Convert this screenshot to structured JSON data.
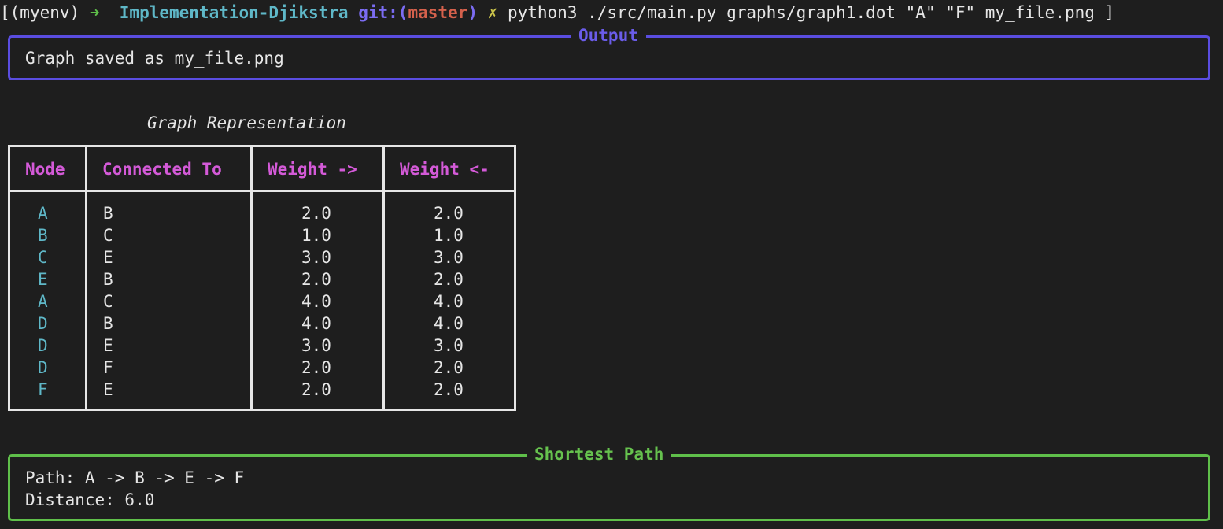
{
  "prompt": {
    "bracket_open": "[",
    "env": "(myenv)",
    "arrow": "➜",
    "dir": "Implementation-Djikstra",
    "git_prefix": "git:(",
    "branch": "master",
    "git_suffix": ")",
    "dirty_mark": "✗",
    "command": "python3 ./src/main.py graphs/graph1.dot \"A\" \"F\" my_file.png",
    "bracket_close": "]"
  },
  "output_panel": {
    "title": "Output",
    "message": "Graph saved as my_file.png"
  },
  "graph_table": {
    "caption": "Graph Representation",
    "headers": [
      "Node",
      "Connected To",
      "Weight ->",
      "Weight <-"
    ],
    "rows": [
      [
        "A",
        "B",
        "2.0",
        "2.0"
      ],
      [
        "B",
        "C",
        "1.0",
        "1.0"
      ],
      [
        "C",
        "E",
        "3.0",
        "3.0"
      ],
      [
        "E",
        "B",
        "2.0",
        "2.0"
      ],
      [
        "A",
        "C",
        "4.0",
        "4.0"
      ],
      [
        "D",
        "B",
        "4.0",
        "4.0"
      ],
      [
        "D",
        "E",
        "3.0",
        "3.0"
      ],
      [
        "D",
        "F",
        "2.0",
        "2.0"
      ],
      [
        "F",
        "E",
        "2.0",
        "2.0"
      ]
    ]
  },
  "path_panel": {
    "title": "Shortest Path",
    "path_line": "Path: A -> B -> E -> F",
    "distance_line": "Distance: 6.0"
  },
  "colors": {
    "background": "#1e1e1e",
    "output_border": "#5a4de0",
    "path_border": "#5fbf4a",
    "header_text": "#d45ad8",
    "node_text": "#5fb8c8"
  }
}
